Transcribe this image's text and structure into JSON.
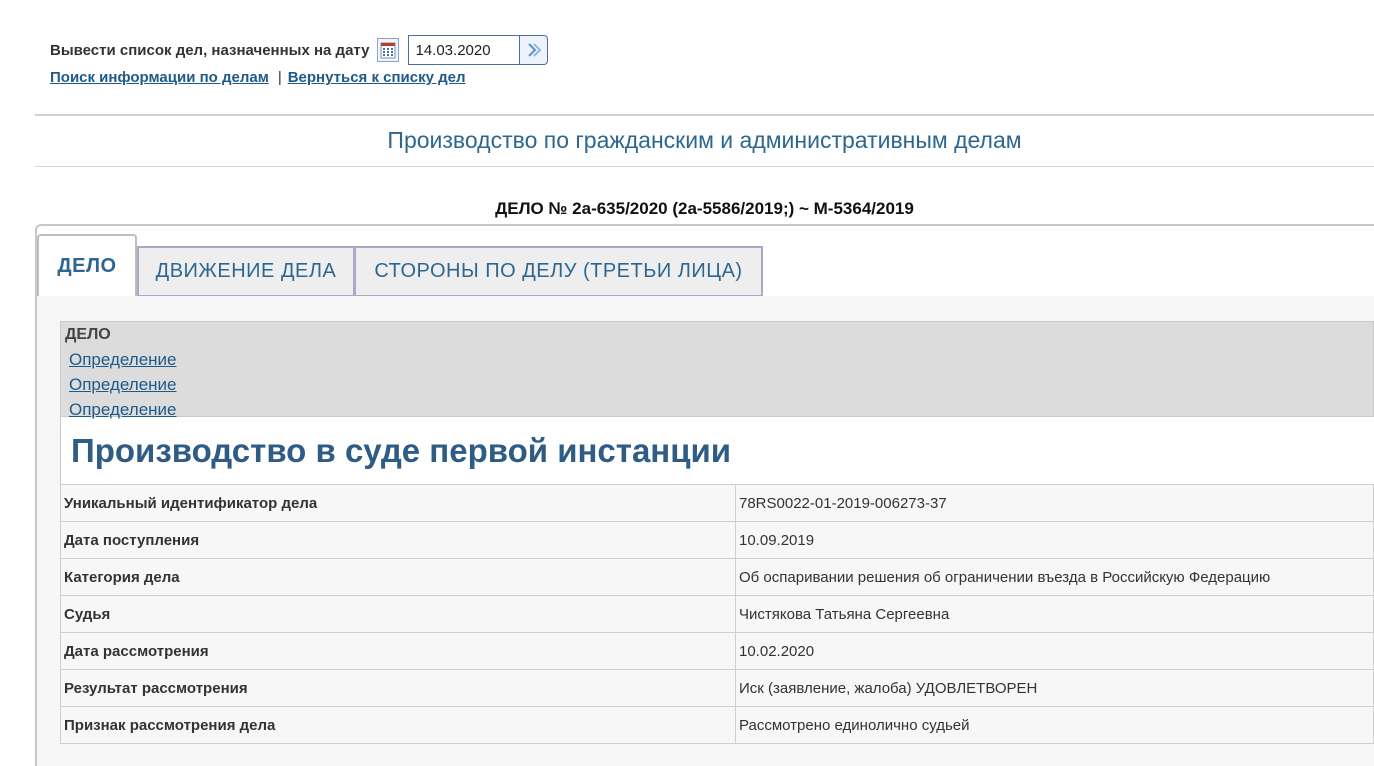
{
  "filter": {
    "label": "Вывести список дел, назначенных на дату",
    "date_value": "14.03.2020",
    "calendar_icon": "calendar-icon",
    "go_icon": "arrow-right-icon"
  },
  "links": {
    "search": "Поиск информации по делам",
    "separator": "|",
    "back": "Вернуться к списку дел"
  },
  "section_title": "Производство по гражданским и административным делам",
  "case_title": "ДЕЛО № 2а-635/2020 (2а-5586/2019;) ~ М-5364/2019",
  "tabs": [
    {
      "label": "ДЕЛО"
    },
    {
      "label": "ДВИЖЕНИЕ ДЕЛА"
    },
    {
      "label": "СТОРОНЫ ПО ДЕЛУ (ТРЕТЬИ ЛИЦА)"
    }
  ],
  "documents": {
    "header": "ДЕЛО",
    "items": [
      "Определение",
      "Определение",
      "Определение"
    ]
  },
  "instance_title": "Производство в суде первой инстанции",
  "info_rows": [
    {
      "key": "Уникальный идентификатор дела",
      "value": "78RS0022-01-2019-006273-37"
    },
    {
      "key": "Дата поступления",
      "value": "10.09.2019"
    },
    {
      "key": "Категория дела",
      "value": "Об оспаривании решения об ограничении въезда в Российскую Федерацию"
    },
    {
      "key": "Судья",
      "value": "Чистякова Татьяна Сергеевна"
    },
    {
      "key": "Дата рассмотрения",
      "value": "10.02.2020"
    },
    {
      "key": "Результат рассмотрения",
      "value": "Иск (заявление, жалоба) УДОВЛЕТВОРЕН"
    },
    {
      "key": "Признак рассмотрения дела",
      "value": "Рассмотрено единолично судьей"
    }
  ],
  "colors": {
    "link": "#1e5a8a",
    "title": "#2d6791",
    "instance": "#2e5c85"
  }
}
